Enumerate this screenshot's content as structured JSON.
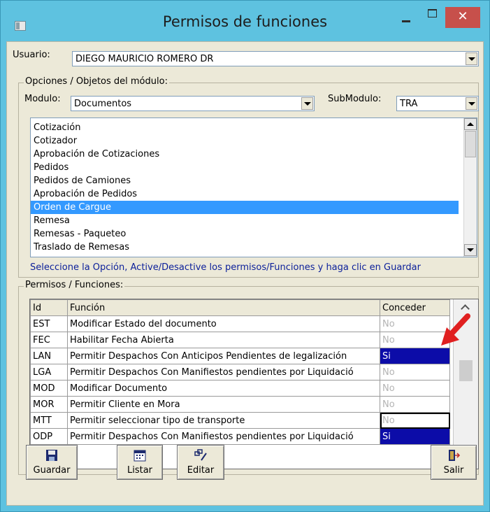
{
  "window": {
    "title": "Permisos de funciones",
    "close_glyph": "✕"
  },
  "usuario": {
    "label": "Usuario:",
    "value": "DIEGO MAURICIO ROMERO DR"
  },
  "opciones": {
    "group_title": "Opciones / Objetos del módulo:",
    "modulo_label": "Modulo:",
    "modulo_value": "Documentos",
    "submodulo_label": "SubModulo:",
    "submodulo_value": "TRA",
    "items": [
      {
        "label": "Cotización",
        "selected": false
      },
      {
        "label": "Cotizador",
        "selected": false
      },
      {
        "label": "Aprobación de Cotizaciones",
        "selected": false
      },
      {
        "label": "Pedidos",
        "selected": false
      },
      {
        "label": "Pedidos de Camiones",
        "selected": false
      },
      {
        "label": "Aprobación de Pedidos",
        "selected": false
      },
      {
        "label": "Orden de Cargue",
        "selected": true
      },
      {
        "label": "Remesa",
        "selected": false
      },
      {
        "label": "Remesas - Paqueteo",
        "selected": false
      },
      {
        "label": "Traslado de Remesas",
        "selected": false
      }
    ],
    "hint": "Seleccione la Opción, Active/Desactive los permisos/Funciones y haga clic en Guardar"
  },
  "permisos": {
    "group_title": "Permisos / Funciones:",
    "columns": [
      "Id",
      "Función",
      "Conceder"
    ],
    "rows": [
      {
        "id": "EST",
        "funcion": "Modificar Estado del documento",
        "conceder": "No"
      },
      {
        "id": "FEC",
        "funcion": "Habilitar Fecha Abierta",
        "conceder": "No"
      },
      {
        "id": "LAN",
        "funcion": "Permitir Despachos Con Anticipos Pendientes de legalización",
        "conceder": "Si"
      },
      {
        "id": "LGA",
        "funcion": "Permitir Despachos Con Manifiestos pendientes por Liquidació",
        "conceder": "No"
      },
      {
        "id": "MOD",
        "funcion": "Modificar Documento",
        "conceder": "No"
      },
      {
        "id": "MOR",
        "funcion": "Permitir Cliente en Mora",
        "conceder": "No"
      },
      {
        "id": "MTT",
        "funcion": "Permitir seleccionar tipo de transporte",
        "conceder": "No"
      },
      {
        "id": "ODP",
        "funcion": "Permitir Despachos Con Manifiestos pendientes por Liquidació",
        "conceder": "Si"
      }
    ]
  },
  "buttons": {
    "guardar": "Guardar",
    "listar": "Listar",
    "editar": "Editar",
    "salir": "Salir"
  },
  "colors": {
    "title_bar": "#5ec2e0",
    "close_button": "#c7504b",
    "selection": "#3399ff",
    "grant_yes": "#0c0ca8",
    "hint_text": "#0b1f9a",
    "annotation_arrow": "#e02020"
  }
}
